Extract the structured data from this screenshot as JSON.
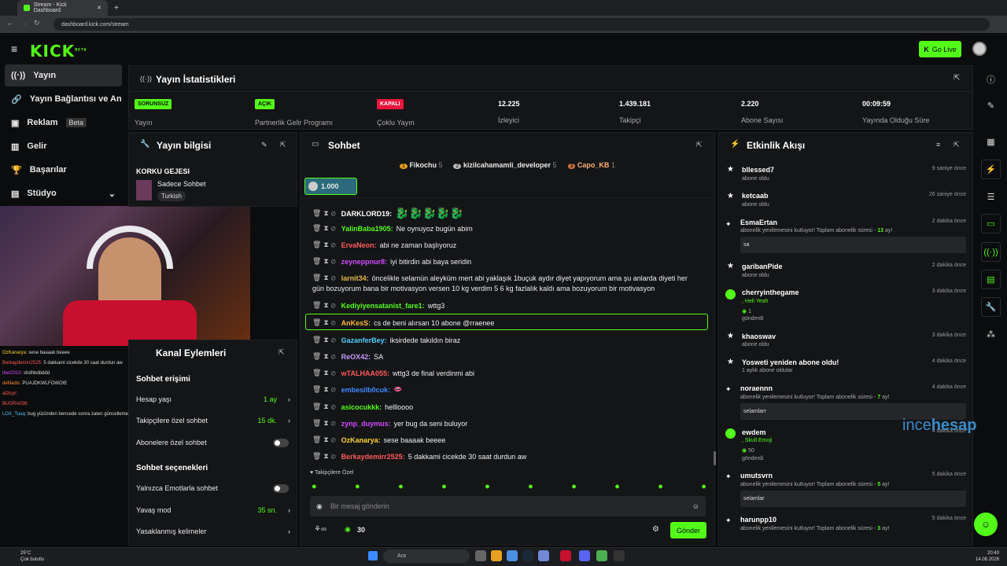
{
  "browser": {
    "tab_title": "Stream - Kick Dashboard",
    "url": "dashboard.kick.com/stream"
  },
  "header": {
    "logo": "KICK",
    "logo_sup": "BETA",
    "go_live": "Go Live"
  },
  "sidebar": {
    "items": [
      {
        "label": "Yayın"
      },
      {
        "label": "Yayın Bağlantısı ve Anahtarı"
      },
      {
        "label": "Reklam",
        "badge": "Beta"
      },
      {
        "label": "Gelir"
      },
      {
        "label": "Başarılar"
      },
      {
        "label": "Stüdyo"
      }
    ]
  },
  "stats": {
    "title": "Yayın İstatistikleri",
    "items": [
      {
        "badge": "SORUNSUZ",
        "label": "Yayın",
        "badge_color": "#53fc18"
      },
      {
        "badge": "AÇIK",
        "label": "Partnerlik Gelir Programı",
        "badge_color": "#53fc18"
      },
      {
        "badge": "KAPALI",
        "label": "Çoklu Yayın",
        "badge_color": "#e8163c"
      },
      {
        "value": "12.225",
        "label": "İzleyici"
      },
      {
        "value": "1.439.181",
        "label": "Takipçi"
      },
      {
        "value": "2.220",
        "label": "Abone Sayısı"
      },
      {
        "value": "00:09:59",
        "label": "Yayında Olduğu Süre"
      }
    ]
  },
  "info": {
    "title": "Yayın bilgisi",
    "stream_title": "KORKU GEJESI",
    "category": "Sadece Sohbet",
    "tag": "Turkish"
  },
  "channel": {
    "title": "Kanal Eylemleri",
    "access_title": "Sohbet erişimi",
    "rows": [
      {
        "label": "Hesap yaşı",
        "value": "1 ay"
      },
      {
        "label": "Takipçilere özel sohbet",
        "value": "15 dk."
      },
      {
        "label": "Abonelere özel sohbet"
      }
    ],
    "options_title": "Sohbet seçenekleri",
    "rows2": [
      {
        "label": "Yalnızca Emotlarla sohbet"
      },
      {
        "label": "Yavaş mod",
        "value": "35 sn."
      },
      {
        "label": "Yasaklanmış kelimeler"
      }
    ]
  },
  "chat": {
    "title": "Sohbet",
    "top_gifters": [
      {
        "rank": "1",
        "name": "Fikochu",
        "count": "5"
      },
      {
        "rank": "2",
        "name": "kizilcahamamli_developer",
        "count": "5"
      },
      {
        "rank": "3",
        "name": "Capo_KB",
        "count": "1"
      }
    ],
    "pinned_amount": "1.000",
    "messages": [
      {
        "user": "DARKLORD19:",
        "color": "#ffffff",
        "text": ""
      },
      {
        "user": "YalinBaba1905:",
        "color": "#53fc18",
        "text": "Ne oynuyoz bugün abim"
      },
      {
        "user": "ErvaNeon:",
        "color": "#ff5a5a",
        "text": "abi ne zaman başlıyoruz"
      },
      {
        "user": "zeyneppnur8:",
        "color": "#d04bff",
        "text": "iyi bitirdin abi baya seridin"
      },
      {
        "user": "larnit34:",
        "color": "#e8b84a",
        "text": "öncelikle selamün aleyküm mert abi yaklaşık 1buçuk aydır diyet yapıyorum ama şu anlarda diyeti her",
        "text2": "gün bozuyorum bana bir motivasyon versen 10 kg verdim 5 6 kg fazlalık kaldı ama bozuyorum bir motivasyon"
      },
      {
        "user": "Kediyiyensatanist_fare1:",
        "color": "#53fc18",
        "text": "wttg3"
      },
      {
        "user": "AnKesS:",
        "color": "#ffb83c",
        "text": "cs de beni alırsan 10 abone @rraenee"
      },
      {
        "user": "GazanferBey:",
        "color": "#4fd1ff",
        "text": "iksirdede takıldın biraz"
      },
      {
        "user": "ReOX42:",
        "color": "#c09aff",
        "text": "SA"
      },
      {
        "user": "wTALHAA055:",
        "color": "#ff5a5a",
        "text": "wttg3 de final verdinmi abi"
      },
      {
        "user": "embesilb0cuk:",
        "color": "#3b8bff",
        "text": ""
      },
      {
        "user": "asicocukkk:",
        "color": "#53fc18",
        "text": "hellloooo"
      },
      {
        "user": "zynp_duymus:",
        "color": "#d04bff",
        "text": "yer bug da seni buluyor"
      },
      {
        "user": "OzKanarya:",
        "color": "#ffd42a",
        "text": "sese baaaak beeee"
      },
      {
        "user": "Berkaydemirr2525:",
        "color": "#ff5a5a",
        "text": "5 dakkami cicekde 30 saat durdun aw"
      }
    ],
    "emote_label": "Takipçilere Özel",
    "placeholder": "Bir mesaj gönderin",
    "points": "30",
    "send": "Gönder"
  },
  "activity": {
    "title": "Etkinlik Akışı",
    "items": [
      {
        "name": "bllessed7",
        "sub": "abone oldu",
        "time": "9 saniye önce"
      },
      {
        "name": "ketcaab",
        "sub": "abone oldu",
        "time": "26 saniye önce"
      },
      {
        "name": "EsmaErtan",
        "sub": "abonelik yenilemesini kutluyor! Toplam abonelik süresi -",
        "months": "13",
        "unit": "ay!",
        "time": "2 dakika önce",
        "msg": "sa"
      },
      {
        "name": "garibanPide",
        "sub": "abone oldu",
        "time": "2 dakika önce"
      },
      {
        "name": "cherryinthegame",
        "sub": ", Heli Yeah",
        "gift": "1",
        "gift_label": "gönderdi",
        "time": "3 dakika önce"
      },
      {
        "name": "khaoswav",
        "sub": "abone oldu",
        "time": "3 dakika önce"
      },
      {
        "name": "Yosweti yeniden abone oldu!",
        "sub": "1 aylık abone oldular",
        "time": "4 dakika önce"
      },
      {
        "name": "noraennn",
        "sub": "abonelik yenilemesini kutluyor! Toplam abonelik süresi -",
        "months": "7",
        "unit": "ay!",
        "time": "4 dakika önce",
        "msg": "selamlarr"
      },
      {
        "name": "ewdem",
        "sub": ", Skull Emoji",
        "gift": "50",
        "gift_label": "gönderdi",
        "time": "4 dakika önce"
      },
      {
        "name": "umutsvrn",
        "sub": "abonelik yenilemesini kutluyor! Toplam abonelik süresi -",
        "months": "5",
        "unit": "ay!",
        "time": "5 dakika önce",
        "msg": "selamlar"
      },
      {
        "name": "harunpp10",
        "sub": "abonelik yenilemesini kutluyor! Toplam abonelik süresi -",
        "months": "3",
        "unit": "ay!",
        "time": "5 dakika önce"
      }
    ]
  },
  "watermark": {
    "a": "ince",
    "b": "hesap",
    ".com": ".com"
  },
  "overlay_chat": [
    {
      "user": "OzKanarya:",
      "text": "sese baaaak beeee"
    },
    {
      "user": "Berkaydemirr2525:",
      "text": "5 dakkami cicekde 30 saat durdun aw"
    },
    {
      "user": "tiliel2010:",
      "text": "shdhbdbddd"
    },
    {
      "user": "defiladis:",
      "text": "PUAJDKWLFOWOIE"
    },
    {
      "user": "al2icyr:",
      "text": ""
    },
    {
      "user": "BUGRA038:",
      "text": ""
    },
    {
      "user": "LOX_Tuuq:",
      "text": "bug yüzünden bencede sonra zaten güncelleme getirdiler ya"
    }
  ],
  "taskbar": {
    "temp": "25°C",
    "weather": "Çok bulutlu",
    "search": "Ara",
    "time": "20:40",
    "date": "14.08.2026"
  },
  "colors": {
    "accent": "#53fc18",
    "panel": "#141517",
    "bg": "#0b0c0d"
  }
}
